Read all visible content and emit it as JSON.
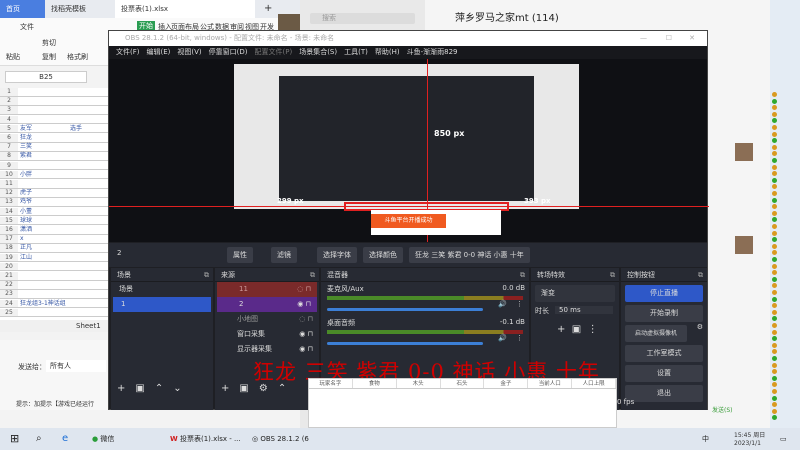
{
  "wps": {
    "tabs": [
      "首页",
      "找稻壳模板",
      "投票表(1).xlsx"
    ],
    "menu": "文件",
    "ribbon_tabs": [
      "开始",
      "插入",
      "页面布局",
      "公式",
      "数据",
      "审阅",
      "视图",
      "开发"
    ],
    "buttons": [
      "粘贴",
      "剪切",
      "复制",
      "格式刷"
    ],
    "name_box": "B25",
    "columns": [
      "A",
      "B"
    ],
    "rows": [
      {
        "n": "1",
        "a": ""
      },
      {
        "n": "2",
        "a": ""
      },
      {
        "n": "3",
        "a": ""
      },
      {
        "n": "4",
        "a": ""
      },
      {
        "n": "5",
        "a": "友军",
        "b": "选手"
      },
      {
        "n": "6",
        "a": "狂龙"
      },
      {
        "n": "7",
        "a": "三笑"
      },
      {
        "n": "8",
        "a": "紫君"
      },
      {
        "n": "9",
        "a": ""
      },
      {
        "n": "10",
        "a": "小胖"
      },
      {
        "n": "11",
        "a": ""
      },
      {
        "n": "12",
        "a": "虎子"
      },
      {
        "n": "13",
        "a": "鸡爷"
      },
      {
        "n": "14",
        "a": "小董"
      },
      {
        "n": "15",
        "a": "球球"
      },
      {
        "n": "16",
        "a": "潇洒"
      },
      {
        "n": "17",
        "a": "x"
      },
      {
        "n": "18",
        "a": "正凡"
      },
      {
        "n": "19",
        "a": "江山"
      },
      {
        "n": "20",
        "a": ""
      },
      {
        "n": "21",
        "a": ""
      },
      {
        "n": "22",
        "a": ""
      },
      {
        "n": "23",
        "a": ""
      },
      {
        "n": "24",
        "a": "狂龙组3-1神话组"
      },
      {
        "n": "25",
        "a": ""
      }
    ],
    "sheet": "Sheet1",
    "send_to_label": "发送给：",
    "send_to_value": "所有人",
    "hint": "提示：加提示【游戏已经运行"
  },
  "wechat": {
    "search_placeholder": "搜索",
    "chat_title": "萍乡罗马之家mt (114)",
    "send": "发送(S)"
  },
  "obs": {
    "title": "OBS 28.1.2 (64-bit, windows) - 配置文件: 未命名 - 场景: 未命名",
    "menu": [
      "文件(F)",
      "编辑(E)",
      "视图(V)",
      "停靠窗口(D)",
      "配置文件(P)",
      "场景集合(S)",
      "工具(T)",
      "帮助(H)",
      "斗鱼-渐渐雨829"
    ],
    "preview": {
      "width_label": "850 px",
      "left_label": "299 px",
      "right_label": "393 px",
      "notice": "斗鱼平台开播成功"
    },
    "selected_source": "2",
    "toolbar": [
      "属性",
      "滤镜",
      "选择字体",
      "选择颜色",
      "狂龙 三笑 紫君 0-0 神话 小惠 十年"
    ],
    "scenes": {
      "title": "场景",
      "items": [
        "场景",
        "1"
      ]
    },
    "sources": {
      "title": "来源",
      "items": [
        "11",
        "2",
        "小地图",
        "窗口采集",
        "显示器采集"
      ]
    },
    "mixer": {
      "title": "混音器",
      "channels": [
        {
          "name": "麦克风/Aux",
          "db": "0.0 dB"
        },
        {
          "name": "桌面音频",
          "db": "-0.1 dB"
        }
      ]
    },
    "transitions": {
      "title": "转场特效",
      "type": "渐变",
      "duration_label": "时长",
      "duration": "50 ms"
    },
    "controls": {
      "title": "控制按钮",
      "buttons": [
        "停止直播",
        "开始录制",
        "启动虚拟摄像机",
        "工作室模式",
        "设置",
        "退出"
      ]
    },
    "fps": "0 fps"
  },
  "overlay_text": "狂龙 三笑 紫君 0-0 神话 小惠 十年",
  "table_headers": [
    "玩家名字",
    "食物",
    "木头",
    "石头",
    "金子",
    "当前人口",
    "人口上限"
  ],
  "taskbar": {
    "apps": [
      "微信",
      "投票表(1).xlsx - ...",
      "OBS 28.1.2 (6"
    ],
    "ime": "中",
    "time": "15:45 周日",
    "date": "2023/1/1"
  }
}
